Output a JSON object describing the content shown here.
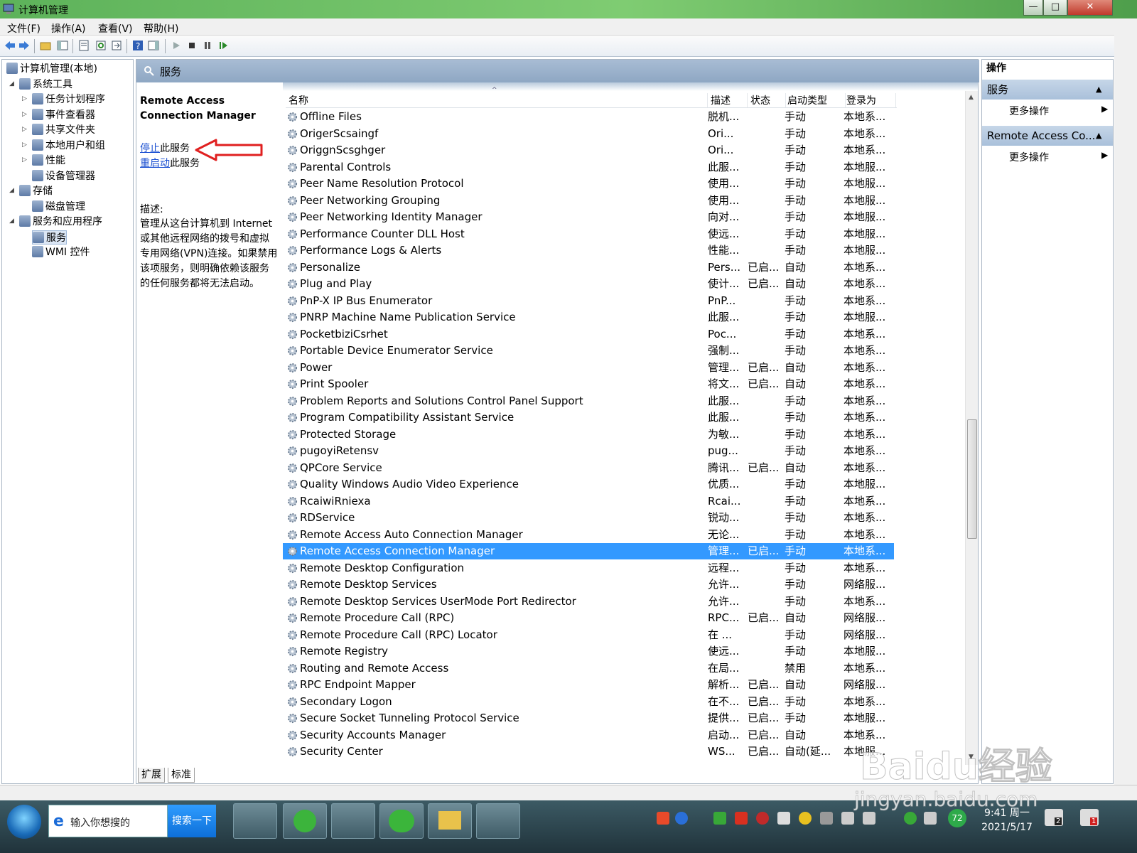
{
  "window": {
    "title": "计算机管理",
    "min": "—",
    "max": "□",
    "close": "✕"
  },
  "menu": [
    "文件(F)",
    "操作(A)",
    "查看(V)",
    "帮助(H)"
  ],
  "tree": [
    {
      "label": "计算机管理(本地)",
      "level": 0,
      "icon": "computer-icon",
      "expander": ""
    },
    {
      "label": "系统工具",
      "level": 1,
      "icon": "tools-icon",
      "expander": "◢"
    },
    {
      "label": "任务计划程序",
      "level": 2,
      "icon": "clock-icon",
      "expander": "▷"
    },
    {
      "label": "事件查看器",
      "level": 2,
      "icon": "event-viewer-icon",
      "expander": "▷"
    },
    {
      "label": "共享文件夹",
      "level": 2,
      "icon": "shared-folder-icon",
      "expander": "▷"
    },
    {
      "label": "本地用户和组",
      "level": 2,
      "icon": "users-icon",
      "expander": "▷"
    },
    {
      "label": "性能",
      "level": 2,
      "icon": "performance-icon",
      "expander": "▷"
    },
    {
      "label": "设备管理器",
      "level": 2,
      "icon": "device-manager-icon",
      "expander": ""
    },
    {
      "label": "存储",
      "level": 1,
      "icon": "storage-icon",
      "expander": "◢"
    },
    {
      "label": "磁盘管理",
      "level": 2,
      "icon": "disk-icon",
      "expander": ""
    },
    {
      "label": "服务和应用程序",
      "level": 1,
      "icon": "services-apps-icon",
      "expander": "◢"
    },
    {
      "label": "服务",
      "level": 2,
      "icon": "services-icon",
      "expander": "",
      "selected": true
    },
    {
      "label": "WMI 控件",
      "level": 2,
      "icon": "wmi-icon",
      "expander": ""
    }
  ],
  "services_header": "服务",
  "extended": {
    "title": "Remote Access Connection Manager",
    "stop_link": "停止",
    "stop_suffix": "此服务",
    "restart_link": "重启动",
    "restart_suffix": "此服务",
    "desc_label": "描述:",
    "desc_text": "管理从这台计算机到 Internet 或其他远程网络的拨号和虚拟专用网络(VPN)连接。如果禁用该项服务，则明确依赖该服务的任何服务都将无法启动。"
  },
  "columns": [
    "名称",
    "描述",
    "状态",
    "启动类型",
    "登录为"
  ],
  "services": [
    {
      "name": "Offline Files",
      "desc": "脱机...",
      "status": "",
      "startup": "手动",
      "logon": "本地系..."
    },
    {
      "name": "OrigerScsaingf",
      "desc": "Ori...",
      "status": "",
      "startup": "手动",
      "logon": "本地系..."
    },
    {
      "name": "OriggnScsghger",
      "desc": "Ori...",
      "status": "",
      "startup": "手动",
      "logon": "本地系..."
    },
    {
      "name": "Parental Controls",
      "desc": "此服...",
      "status": "",
      "startup": "手动",
      "logon": "本地服..."
    },
    {
      "name": "Peer Name Resolution Protocol",
      "desc": "使用...",
      "status": "",
      "startup": "手动",
      "logon": "本地服..."
    },
    {
      "name": "Peer Networking Grouping",
      "desc": "使用...",
      "status": "",
      "startup": "手动",
      "logon": "本地服..."
    },
    {
      "name": "Peer Networking Identity Manager",
      "desc": "向对...",
      "status": "",
      "startup": "手动",
      "logon": "本地服..."
    },
    {
      "name": "Performance Counter DLL Host",
      "desc": "使远...",
      "status": "",
      "startup": "手动",
      "logon": "本地服..."
    },
    {
      "name": "Performance Logs & Alerts",
      "desc": "性能...",
      "status": "",
      "startup": "手动",
      "logon": "本地服..."
    },
    {
      "name": "Personalize",
      "desc": "Pers...",
      "status": "已启...",
      "startup": "自动",
      "logon": "本地系..."
    },
    {
      "name": "Plug and Play",
      "desc": "使计...",
      "status": "已启...",
      "startup": "自动",
      "logon": "本地系..."
    },
    {
      "name": "PnP-X IP Bus Enumerator",
      "desc": "PnP...",
      "status": "",
      "startup": "手动",
      "logon": "本地系..."
    },
    {
      "name": "PNRP Machine Name Publication Service",
      "desc": "此服...",
      "status": "",
      "startup": "手动",
      "logon": "本地服..."
    },
    {
      "name": "PocketbiziCsrhet",
      "desc": "Poc...",
      "status": "",
      "startup": "手动",
      "logon": "本地系..."
    },
    {
      "name": "Portable Device Enumerator Service",
      "desc": "强制...",
      "status": "",
      "startup": "手动",
      "logon": "本地系..."
    },
    {
      "name": "Power",
      "desc": "管理...",
      "status": "已启...",
      "startup": "自动",
      "logon": "本地系..."
    },
    {
      "name": "Print Spooler",
      "desc": "将文...",
      "status": "已启...",
      "startup": "自动",
      "logon": "本地系..."
    },
    {
      "name": "Problem Reports and Solutions Control Panel Support",
      "desc": "此服...",
      "status": "",
      "startup": "手动",
      "logon": "本地系..."
    },
    {
      "name": "Program Compatibility Assistant Service",
      "desc": "此服...",
      "status": "",
      "startup": "手动",
      "logon": "本地系..."
    },
    {
      "name": "Protected Storage",
      "desc": "为敏...",
      "status": "",
      "startup": "手动",
      "logon": "本地系..."
    },
    {
      "name": "pugoyiRetensv",
      "desc": "pug...",
      "status": "",
      "startup": "手动",
      "logon": "本地系..."
    },
    {
      "name": "QPCore Service",
      "desc": "腾讯...",
      "status": "已启...",
      "startup": "自动",
      "logon": "本地系..."
    },
    {
      "name": "Quality Windows Audio Video Experience",
      "desc": "优质...",
      "status": "",
      "startup": "手动",
      "logon": "本地服..."
    },
    {
      "name": "RcaiwiRniexa",
      "desc": "Rcai...",
      "status": "",
      "startup": "手动",
      "logon": "本地系..."
    },
    {
      "name": "RDService",
      "desc": "锐动...",
      "status": "",
      "startup": "手动",
      "logon": "本地系..."
    },
    {
      "name": "Remote Access Auto Connection Manager",
      "desc": "无论...",
      "status": "",
      "startup": "手动",
      "logon": "本地系..."
    },
    {
      "name": "Remote Access Connection Manager",
      "desc": "管理...",
      "status": "已启...",
      "startup": "手动",
      "logon": "本地系...",
      "selected": true
    },
    {
      "name": "Remote Desktop Configuration",
      "desc": "远程...",
      "status": "",
      "startup": "手动",
      "logon": "本地系..."
    },
    {
      "name": "Remote Desktop Services",
      "desc": "允许...",
      "status": "",
      "startup": "手动",
      "logon": "网络服..."
    },
    {
      "name": "Remote Desktop Services UserMode Port Redirector",
      "desc": "允许...",
      "status": "",
      "startup": "手动",
      "logon": "本地系..."
    },
    {
      "name": "Remote Procedure Call (RPC)",
      "desc": "RPC...",
      "status": "已启...",
      "startup": "自动",
      "logon": "网络服..."
    },
    {
      "name": "Remote Procedure Call (RPC) Locator",
      "desc": "在 ...",
      "status": "",
      "startup": "手动",
      "logon": "网络服..."
    },
    {
      "name": "Remote Registry",
      "desc": "使远...",
      "status": "",
      "startup": "手动",
      "logon": "本地服..."
    },
    {
      "name": "Routing and Remote Access",
      "desc": "在局...",
      "status": "",
      "startup": "禁用",
      "logon": "本地系..."
    },
    {
      "name": "RPC Endpoint Mapper",
      "desc": "解析...",
      "status": "已启...",
      "startup": "自动",
      "logon": "网络服..."
    },
    {
      "name": "Secondary Logon",
      "desc": "在不...",
      "status": "已启...",
      "startup": "手动",
      "logon": "本地系..."
    },
    {
      "name": "Secure Socket Tunneling Protocol Service",
      "desc": "提供...",
      "status": "已启...",
      "startup": "手动",
      "logon": "本地服..."
    },
    {
      "name": "Security Accounts Manager",
      "desc": "启动...",
      "status": "已启...",
      "startup": "自动",
      "logon": "本地系..."
    },
    {
      "name": "Security Center",
      "desc": "WS...",
      "status": "已启...",
      "startup": "自动(延...",
      "logon": "本地服..."
    }
  ],
  "bottom_tabs": [
    "扩展",
    "标准"
  ],
  "actions": {
    "header": "操作",
    "section1": "服务",
    "more1": "更多操作",
    "section2": "Remote Access Co...",
    "more2": "更多操作"
  },
  "taskbar": {
    "search_placeholder": "输入你想搜的",
    "search_button": "搜索一下",
    "time": "9:41 周一",
    "date": "2021/5/17",
    "badge_72": "72",
    "badge_2": "2",
    "badge_1": "1"
  },
  "watermark": {
    "brand": "Baidu经验",
    "url": "jingyan.baidu.com"
  },
  "colors": {
    "selection": "#3399ff",
    "link": "#1a4fd1",
    "annotation_arrow": "#e02020",
    "header_bg": "#8ea7c3"
  }
}
